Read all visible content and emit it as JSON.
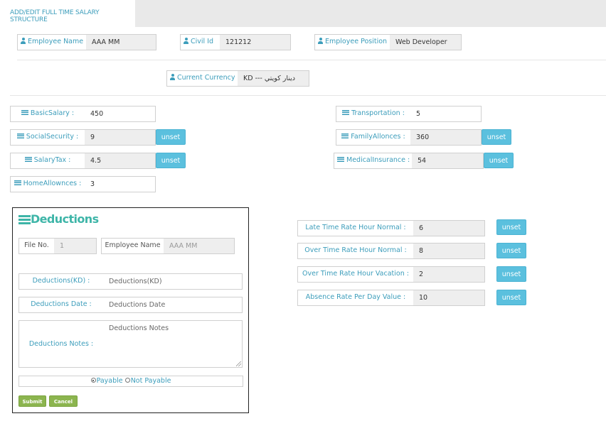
{
  "tab": {
    "active_label": "ADD/EDIT FULL TIME SALARY STRUCTURE"
  },
  "employee": {
    "name_label": "Employee Name",
    "name_value": "AAA MM",
    "civil_label": "Civil Id",
    "civil_value": "121212",
    "position_label": "Employee Position",
    "position_value": "Web Developer"
  },
  "currency": {
    "label": "Current Currency",
    "value": "KD --- دينار كويتي"
  },
  "salary": {
    "basic_label": "BasicSalary :",
    "basic_value": "450",
    "social_label": "SocialSecurity :",
    "social_value": "9",
    "tax_label": "SalaryTax :",
    "tax_value": "4.5",
    "home_label": "HomeAllownces :",
    "home_value": "3",
    "transport_label": "Transportation :",
    "transport_value": "5",
    "family_label": "FamilyAllonces :",
    "family_value": "360",
    "medical_label": "MedicalInsurance :",
    "medical_value": "54"
  },
  "unset_label": "unset",
  "rates": {
    "late_label": "Late Time Rate Hour Normal :",
    "late_value": "6",
    "overnormal_label": "Over Time Rate Hour Normal :",
    "overnormal_value": "8",
    "overvac_label": "Over Time Rate Hour Vacation :",
    "overvac_value": "2",
    "absence_label": "Absence Rate Per Day Value :",
    "absence_value": "10"
  },
  "deductions": {
    "title": "Deductions",
    "file_label": "File No.",
    "file_value": "1",
    "emp_label": "Employee Name",
    "emp_value": "AAA MM",
    "amount_label": "Deductions(KD) :",
    "amount_placeholder": "Deductions(KD)",
    "date_label": "Deductions Date :",
    "date_placeholder": "Deductions Date",
    "notes_label": "Deductions Notes :",
    "notes_placeholder": "Deductions Notes",
    "payable_label": "Payable",
    "not_payable_label": "Not Payable",
    "submit_label": "Submit",
    "cancel_label": "Cancel"
  },
  "colors": {
    "accent": "#3c9dbb",
    "unset_button": "#5bc0de",
    "title_green": "#3eb5a8",
    "submit_green": "#8cb54f"
  },
  "icons": {
    "field_user": "user-icon",
    "field_list": "list-icon"
  }
}
